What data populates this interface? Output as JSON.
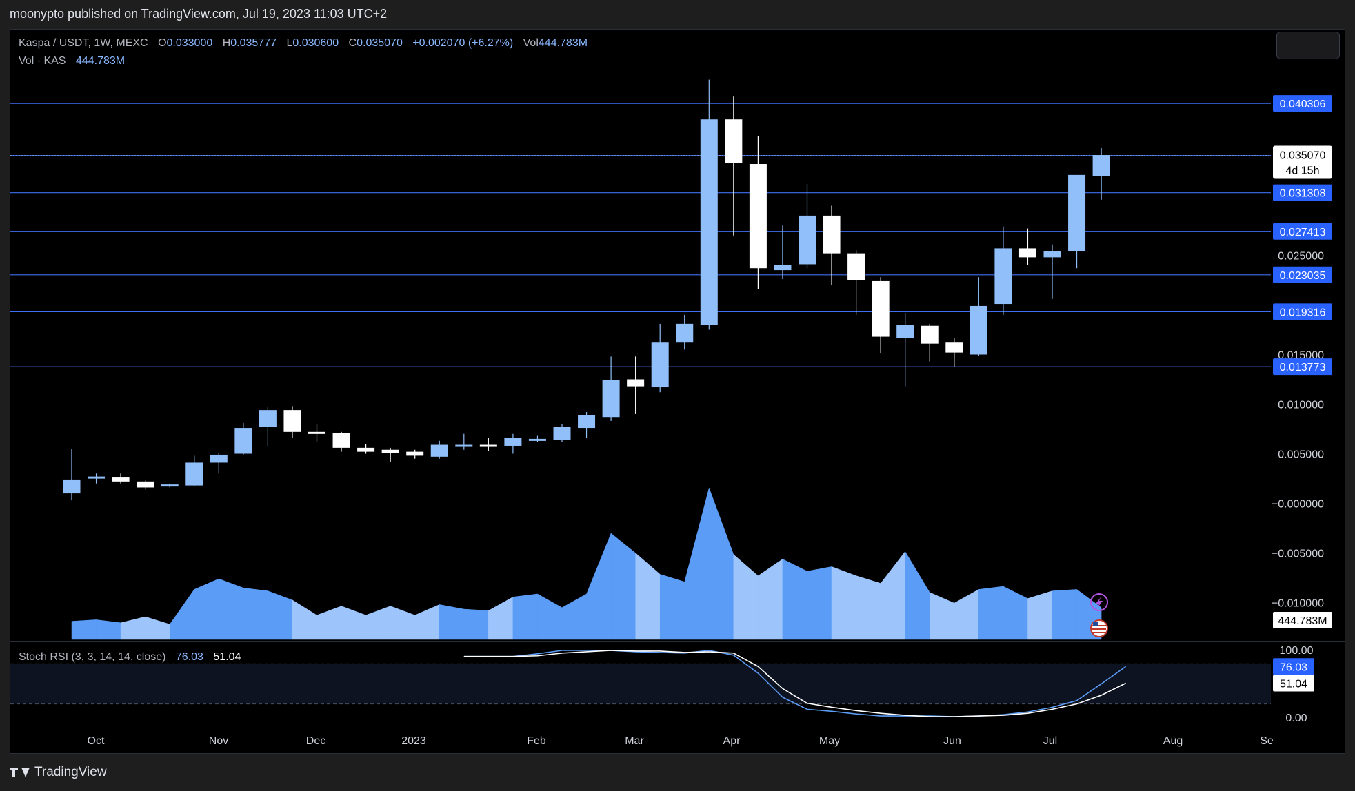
{
  "header": {
    "published": "moonypto published on TradingView.com, Jul 19, 2023 11:03 UTC+2"
  },
  "legend": {
    "symbol": "Kaspa / USDT, 1W, MEXC",
    "o_label": "O",
    "o_value": "0.033000",
    "h_label": "H",
    "h_value": "0.035777",
    "l_label": "L",
    "l_value": "0.030600",
    "c_label": "C",
    "c_value": "0.035070",
    "change": "+0.002070 (+6.27%)",
    "vol_label": "Vol",
    "vol_value": "444.783M",
    "vol_row_label": "Vol · KAS",
    "vol_row_value": "444.783M"
  },
  "stoch_legend": {
    "label": "Stoch RSI (3, 3, 14, 14, close)",
    "k_value": "76.03",
    "d_value": "51.04"
  },
  "footer": {
    "brand": "TradingView"
  },
  "colors": {
    "background": "#000000",
    "up": "#90bff9",
    "down": "#ffffff",
    "level_line": "#2962ff",
    "label_bg": "#2962ff",
    "volume": "#5b9cf6",
    "k_line": "#5b9cf6",
    "d_line": "#ffffff"
  },
  "icons": [
    "lightning-icon",
    "us-flag-icon",
    "tradingview-logo-icon"
  ],
  "chart_data": {
    "type": "candlestick",
    "symbol": "Kaspa / USDT",
    "interval": "1W",
    "exchange": "MEXC",
    "price_axis_ticks": [
      "0.015000",
      "0.010000",
      "0.005000",
      "−0.000000",
      "−0.005000",
      "−0.010000"
    ],
    "price_axis_extra": [
      "0.025000"
    ],
    "time_axis_ticks": [
      "Oct",
      "Nov",
      "Dec",
      "2023",
      "Feb",
      "Mar",
      "Apr",
      "May",
      "Jun",
      "Jul",
      "Aug",
      "Se"
    ],
    "level_lines": [
      "0.040306",
      "0.035055",
      "0.031308",
      "0.027413",
      "0.023035",
      "0.019316",
      "0.013773"
    ],
    "current_price_label": "0.035070",
    "countdown": "4d 15h",
    "volume_label": "444.783M",
    "candles": [
      {
        "o": 0.001,
        "h": 0.0055,
        "l": 0.0003,
        "c": 0.0024
      },
      {
        "o": 0.0026,
        "h": 0.003,
        "l": 0.002,
        "c": 0.0027
      },
      {
        "o": 0.0026,
        "h": 0.003,
        "l": 0.002,
        "c": 0.0022
      },
      {
        "o": 0.0022,
        "h": 0.0023,
        "l": 0.0014,
        "c": 0.0016
      },
      {
        "o": 0.0017,
        "h": 0.002,
        "l": 0.0016,
        "c": 0.0019
      },
      {
        "o": 0.0018,
        "h": 0.0048,
        "l": 0.0017,
        "c": 0.0041
      },
      {
        "o": 0.0041,
        "h": 0.0051,
        "l": 0.003,
        "c": 0.0049
      },
      {
        "o": 0.005,
        "h": 0.0081,
        "l": 0.0049,
        "c": 0.0076
      },
      {
        "o": 0.0077,
        "h": 0.0097,
        "l": 0.0057,
        "c": 0.0094
      },
      {
        "o": 0.0094,
        "h": 0.0098,
        "l": 0.0066,
        "c": 0.0072
      },
      {
        "o": 0.0072,
        "h": 0.008,
        "l": 0.0062,
        "c": 0.007
      },
      {
        "o": 0.0071,
        "h": 0.0072,
        "l": 0.0052,
        "c": 0.0056
      },
      {
        "o": 0.0056,
        "h": 0.006,
        "l": 0.005,
        "c": 0.0052
      },
      {
        "o": 0.0054,
        "h": 0.0056,
        "l": 0.0042,
        "c": 0.0051
      },
      {
        "o": 0.0052,
        "h": 0.0054,
        "l": 0.0045,
        "c": 0.0048
      },
      {
        "o": 0.0047,
        "h": 0.0063,
        "l": 0.0045,
        "c": 0.0059
      },
      {
        "o": 0.0059,
        "h": 0.007,
        "l": 0.0054,
        "c": 0.0059
      },
      {
        "o": 0.0059,
        "h": 0.0066,
        "l": 0.0053,
        "c": 0.0058
      },
      {
        "o": 0.0058,
        "h": 0.007,
        "l": 0.005,
        "c": 0.0066
      },
      {
        "o": 0.0065,
        "h": 0.0068,
        "l": 0.0062,
        "c": 0.0065
      },
      {
        "o": 0.0064,
        "h": 0.008,
        "l": 0.0062,
        "c": 0.0077
      },
      {
        "o": 0.0076,
        "h": 0.0092,
        "l": 0.0066,
        "c": 0.0089
      },
      {
        "o": 0.0087,
        "h": 0.0148,
        "l": 0.0083,
        "c": 0.0124
      },
      {
        "o": 0.0125,
        "h": 0.0148,
        "l": 0.009,
        "c": 0.0118
      },
      {
        "o": 0.0117,
        "h": 0.0181,
        "l": 0.0112,
        "c": 0.0162
      },
      {
        "o": 0.0162,
        "h": 0.019,
        "l": 0.0155,
        "c": 0.0181
      },
      {
        "o": 0.018,
        "h": 0.0427,
        "l": 0.0175,
        "c": 0.0387
      },
      {
        "o": 0.0387,
        "h": 0.041,
        "l": 0.027,
        "c": 0.0343
      },
      {
        "o": 0.0342,
        "h": 0.037,
        "l": 0.0216,
        "c": 0.0237
      },
      {
        "o": 0.0235,
        "h": 0.028,
        "l": 0.0226,
        "c": 0.024
      },
      {
        "o": 0.0241,
        "h": 0.0322,
        "l": 0.0237,
        "c": 0.029
      },
      {
        "o": 0.029,
        "h": 0.03,
        "l": 0.022,
        "c": 0.0252
      },
      {
        "o": 0.0252,
        "h": 0.0255,
        "l": 0.019,
        "c": 0.0225
      },
      {
        "o": 0.0224,
        "h": 0.0228,
        "l": 0.0151,
        "c": 0.0168
      },
      {
        "o": 0.0167,
        "h": 0.0192,
        "l": 0.0118,
        "c": 0.018
      },
      {
        "o": 0.0179,
        "h": 0.0181,
        "l": 0.0143,
        "c": 0.0161
      },
      {
        "o": 0.0162,
        "h": 0.0167,
        "l": 0.0138,
        "c": 0.0152
      },
      {
        "o": 0.015,
        "h": 0.0228,
        "l": 0.0149,
        "c": 0.0199
      },
      {
        "o": 0.0201,
        "h": 0.0279,
        "l": 0.019,
        "c": 0.0257
      },
      {
        "o": 0.0257,
        "h": 0.0277,
        "l": 0.024,
        "c": 0.0248
      },
      {
        "o": 0.0248,
        "h": 0.0261,
        "l": 0.0206,
        "c": 0.0254
      },
      {
        "o": 0.0254,
        "h": 0.0323,
        "l": 0.0237,
        "c": 0.0331
      },
      {
        "o": 0.033,
        "h": 0.0358,
        "l": 0.0306,
        "c": 0.0351
      }
    ],
    "volume": [
      0.12,
      0.13,
      0.11,
      0.15,
      0.1,
      0.33,
      0.4,
      0.34,
      0.32,
      0.26,
      0.16,
      0.22,
      0.16,
      0.22,
      0.16,
      0.23,
      0.2,
      0.19,
      0.28,
      0.3,
      0.21,
      0.3,
      0.7,
      0.57,
      0.43,
      0.38,
      1.0,
      0.56,
      0.42,
      0.53,
      0.45,
      0.48,
      0.42,
      0.37,
      0.58,
      0.31,
      0.24,
      0.33,
      0.35,
      0.27,
      0.32,
      0.33,
      0.21
    ],
    "stoch_rsi": {
      "params": "(3, 3, 14, 14, close)",
      "upper_band": 80,
      "lower_band": 20,
      "mid_band": 50,
      "axis_ticks": [
        "100.00",
        "0.00"
      ],
      "start_index": 17,
      "k": [
        91,
        91,
        95,
        100,
        100,
        100,
        98,
        97,
        96,
        100,
        93,
        66,
        30,
        12,
        9,
        5,
        2,
        2,
        2,
        1,
        2,
        4,
        8,
        15,
        25,
        50,
        76.03
      ],
      "d": [
        91,
        91,
        92,
        96,
        98,
        100,
        99,
        99,
        97,
        98,
        96,
        76,
        43,
        21,
        15,
        10,
        6,
        3,
        1,
        1,
        2,
        3,
        6,
        12,
        20,
        33,
        51.04
      ]
    }
  }
}
